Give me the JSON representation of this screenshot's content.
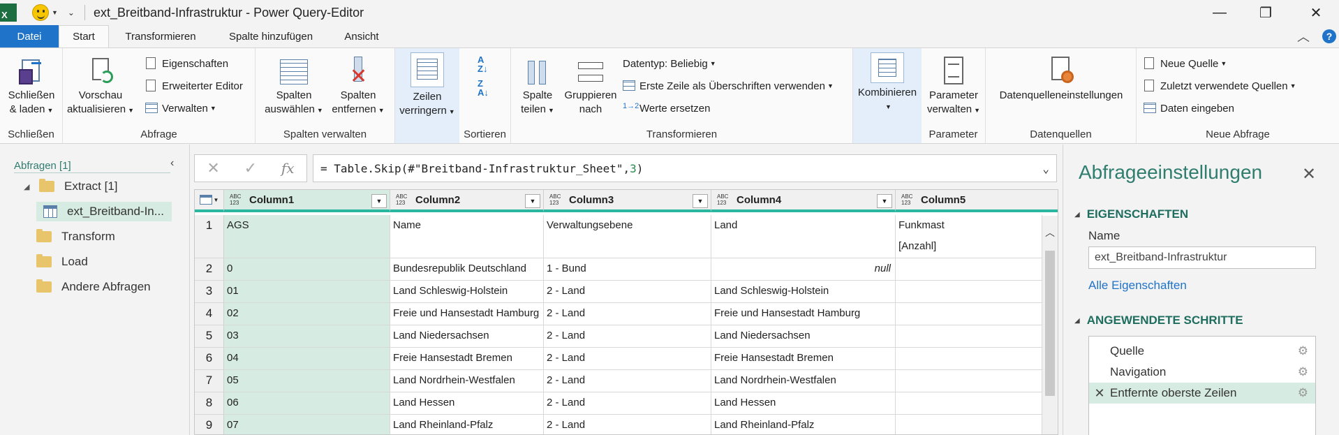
{
  "window": {
    "app_logo": "X",
    "title": "ext_Breitband-Infrastruktur - Power Query-Editor",
    "minimize": "—",
    "restore": "❐",
    "close": "✕"
  },
  "tabs": [
    {
      "label": "Datei"
    },
    {
      "label": "Start"
    },
    {
      "label": "Transformieren"
    },
    {
      "label": "Spalte hinzufügen"
    },
    {
      "label": "Ansicht"
    }
  ],
  "tabs_right": {
    "collapse": "︿",
    "help": "?"
  },
  "ribbon": {
    "schliessen": {
      "group": "Schließen",
      "btn_line1": "Schließen",
      "btn_line2": "& laden"
    },
    "abfrage": {
      "group": "Abfrage",
      "vorschau_line1": "Vorschau",
      "vorschau_line2": "aktualisieren",
      "eigenschaften": "Eigenschaften",
      "erweiterter_editor": "Erweiterter Editor",
      "verwalten": "Verwalten"
    },
    "spalten_verwalten": {
      "group": "Spalten verwalten",
      "auswaehlen_line1": "Spalten",
      "auswaehlen_line2": "auswählen",
      "entfernen_line1": "Spalten",
      "entfernen_line2": "entfernen"
    },
    "zeilen": {
      "line1": "Zeilen",
      "line2": "verringern"
    },
    "sortieren": {
      "group": "Sortieren"
    },
    "transformieren": {
      "group": "Transformieren",
      "teilen_line1": "Spalte",
      "teilen_line2": "teilen",
      "gruppieren_line1": "Gruppieren",
      "gruppieren_line2": "nach",
      "datentyp": "Datentyp: Beliebig",
      "erste_zeile": "Erste Zeile als Überschriften verwenden",
      "werte_ersetzen": "Werte ersetzen"
    },
    "kombinieren": {
      "label": "Kombinieren"
    },
    "parameter": {
      "group": "Parameter",
      "line1": "Parameter",
      "line2": "verwalten"
    },
    "datenquellen": {
      "group": "Datenquellen",
      "label": "Datenquelleneinstellungen"
    },
    "neue_abfrage": {
      "group": "Neue Abfrage",
      "neue_quelle": "Neue Quelle",
      "zuletzt": "Zuletzt verwendete Quellen",
      "daten_eingeben": "Daten eingeben"
    }
  },
  "queries": {
    "header": "Abfragen [1]",
    "collapse": "‹",
    "items": [
      {
        "label": "Extract [1]"
      },
      {
        "label": "ext_Breitband-In..."
      },
      {
        "label": "Transform"
      },
      {
        "label": "Load"
      },
      {
        "label": "Andere Abfragen"
      }
    ]
  },
  "formula": {
    "cancel": "✕",
    "confirm": "✓",
    "fx": "fx",
    "prefix": "= Table.Skip(#\"Breitband-Infrastruktur_Sheet\",",
    "number": "3",
    "suffix": ")"
  },
  "grid": {
    "type_label_top": "ABC",
    "type_label_bottom": "123",
    "columns": [
      "Column1",
      "Column2",
      "Column3",
      "Column4",
      "Column5"
    ],
    "rows": [
      {
        "n": "1",
        "c1": "AGS",
        "c2": "Name",
        "c3": "Verwaltungsebene",
        "c4": "Land",
        "c5a": "Funkmast",
        "c5b": "[Anzahl]"
      },
      {
        "n": "2",
        "c1": "0",
        "c2": "Bundesrepublik Deutschland",
        "c3": "1 - Bund",
        "c4": "null",
        "c5": ""
      },
      {
        "n": "3",
        "c1": "01",
        "c2": "Land Schleswig-Holstein",
        "c3": "2 - Land",
        "c4": "Land Schleswig-Holstein",
        "c5": ""
      },
      {
        "n": "4",
        "c1": "02",
        "c2": "Freie und Hansestadt Hamburg",
        "c3": "2 - Land",
        "c4": "Freie und Hansestadt Hamburg",
        "c5": ""
      },
      {
        "n": "5",
        "c1": "03",
        "c2": "Land Niedersachsen",
        "c3": "2 - Land",
        "c4": "Land Niedersachsen",
        "c5": ""
      },
      {
        "n": "6",
        "c1": "04",
        "c2": "Freie Hansestadt Bremen",
        "c3": "2 - Land",
        "c4": "Freie Hansestadt Bremen",
        "c5": ""
      },
      {
        "n": "7",
        "c1": "05",
        "c2": "Land Nordrhein-Westfalen",
        "c3": "2 - Land",
        "c4": "Land Nordrhein-Westfalen",
        "c5": ""
      },
      {
        "n": "8",
        "c1": "06",
        "c2": "Land Hessen",
        "c3": "2 - Land",
        "c4": "Land Hessen",
        "c5": ""
      },
      {
        "n": "9",
        "c1": "07",
        "c2": "Land Rheinland-Pfalz",
        "c3": "2 - Land",
        "c4": "Land Rheinland-Pfalz",
        "c5": ""
      }
    ]
  },
  "settings": {
    "title": "Abfrageeinstellungen",
    "close": "✕",
    "eigenschaften": "EIGENSCHAFTEN",
    "name_label": "Name",
    "name_value": "ext_Breitband-Infrastruktur",
    "alle_eigenschaften": "Alle Eigenschaften",
    "schritte": "ANGEWENDETE SCHRITTE",
    "steps": [
      {
        "label": "Quelle"
      },
      {
        "label": "Navigation"
      },
      {
        "label": "Entfernte oberste Zeilen"
      }
    ],
    "step_delete": "✕",
    "step_gear": "⚙"
  },
  "colors": {
    "accent": "#1f73c9",
    "teal": "#2f7d6e",
    "selection": "#d6ebe2",
    "header_bar": "#2ab7a0"
  }
}
